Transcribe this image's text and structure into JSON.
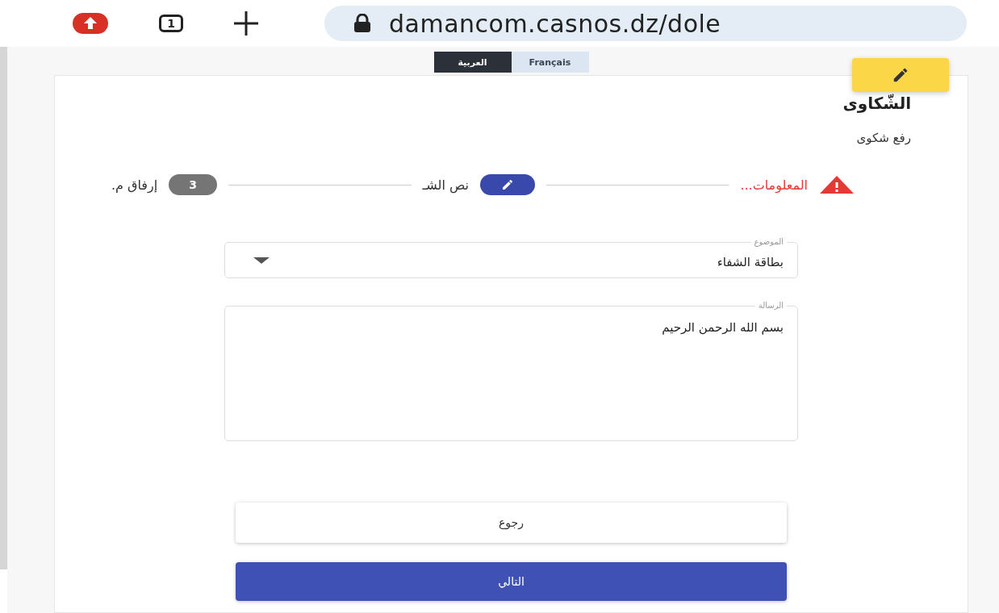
{
  "browser": {
    "tab_count": "1",
    "url": "damancom.casnos.dz/dole"
  },
  "languages": [
    {
      "label": "Français",
      "selected": false
    },
    {
      "label": "العربية",
      "selected": true
    }
  ],
  "title": "الشّكاوى",
  "subtitle": "رفع شكوى",
  "steps": [
    {
      "kind": "error",
      "label": "المعلومات..."
    },
    {
      "kind": "active",
      "label": "نص الشـ"
    },
    {
      "kind": "number",
      "number": "3",
      "label": "إرفاق م."
    }
  ],
  "fields": [
    {
      "kind": "select",
      "label": "الموضوع",
      "value": "بطاقة الشفاء"
    },
    {
      "kind": "textarea",
      "label": "الرسالة",
      "value": "بسم الله الرحمن الرحيم"
    }
  ],
  "buttons": [
    {
      "kind": "secondary",
      "label": "رجوع"
    },
    {
      "kind": "primary",
      "label": "التالي"
    }
  ]
}
